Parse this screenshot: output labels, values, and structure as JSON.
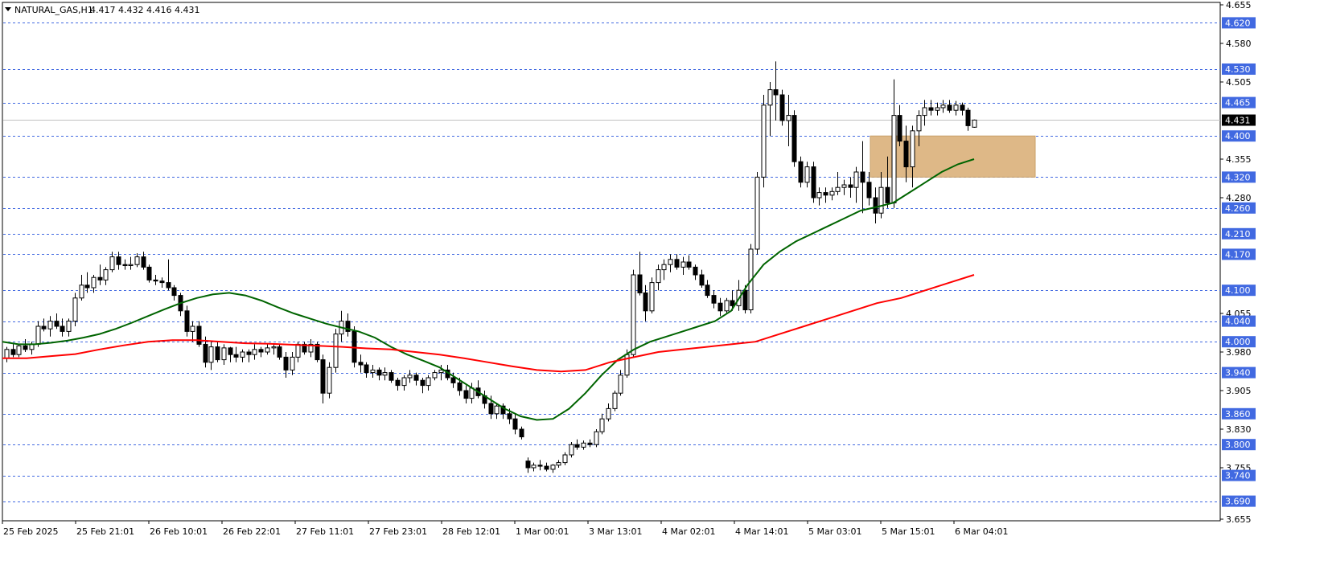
{
  "header": {
    "menu_icon": "triangle-down-icon",
    "symbol": "NATURAL_GAS,H1",
    "ohlc": "4.417 4.432 4.416 4.431"
  },
  "chart_data": {
    "type": "candlestick",
    "symbol": "NATURAL_GAS",
    "timeframe": "H1",
    "ylim": [
      3.655,
      4.655
    ],
    "y_ticks": [
      "4.655",
      "4.580",
      "4.505",
      "4.355",
      "4.280",
      "4.055",
      "3.980",
      "3.905",
      "3.830",
      "3.755",
      "3.655"
    ],
    "x_ticks": [
      "25 Feb 2025",
      "25 Feb 21:01",
      "26 Feb 10:01",
      "26 Feb 22:01",
      "27 Feb 11:01",
      "27 Feb 23:01",
      "28 Feb 12:01",
      "1 Mar 00:01",
      "3 Mar 13:01",
      "4 Mar 02:01",
      "4 Mar 14:01",
      "5 Mar 03:01",
      "5 Mar 15:01",
      "6 Mar 04:01"
    ],
    "current_price": "4.431",
    "level_lines": [
      "4.620",
      "4.530",
      "4.465",
      "4.400",
      "4.320",
      "4.260",
      "4.210",
      "4.170",
      "4.100",
      "4.040",
      "4.000",
      "3.940",
      "3.860",
      "3.800",
      "3.740",
      "3.690"
    ],
    "zone": {
      "from": 4.32,
      "to": 4.4,
      "color": "#deb887"
    },
    "colors": {
      "up_body": "#ffffff",
      "down_body": "#000000",
      "wick": "#000000",
      "grid": "#4169e1",
      "label_bg": "#4169e1",
      "ma_fast": "#006400",
      "ma_slow": "#ff0000",
      "current_line": "#c0c0c0",
      "current_label_bg": "#000000"
    },
    "candles": [
      [
        3.968,
        3.99,
        3.96,
        3.985
      ],
      [
        3.985,
        3.995,
        3.97,
        3.975
      ],
      [
        3.975,
        3.995,
        3.97,
        3.992
      ],
      [
        3.992,
        4.005,
        3.98,
        3.985
      ],
      [
        3.985,
        4.0,
        3.975,
        3.995
      ],
      [
        3.995,
        4.04,
        3.99,
        4.03
      ],
      [
        4.03,
        4.045,
        4.02,
        4.025
      ],
      [
        4.025,
        4.05,
        4.01,
        4.04
      ],
      [
        4.04,
        4.055,
        4.025,
        4.03
      ],
      [
        4.03,
        4.045,
        4.01,
        4.02
      ],
      [
        4.02,
        4.045,
        4.01,
        4.04
      ],
      [
        4.04,
        4.095,
        4.03,
        4.085
      ],
      [
        4.085,
        4.13,
        4.08,
        4.11
      ],
      [
        4.11,
        4.135,
        4.095,
        4.105
      ],
      [
        4.105,
        4.13,
        4.095,
        4.125
      ],
      [
        4.125,
        4.15,
        4.11,
        4.12
      ],
      [
        4.12,
        4.145,
        4.11,
        4.14
      ],
      [
        4.14,
        4.175,
        4.135,
        4.165
      ],
      [
        4.165,
        4.175,
        4.14,
        4.15
      ],
      [
        4.15,
        4.16,
        4.14,
        4.148
      ],
      [
        4.148,
        4.165,
        4.14,
        4.15
      ],
      [
        4.15,
        4.172,
        4.145,
        4.165
      ],
      [
        4.165,
        4.175,
        4.14,
        4.145
      ],
      [
        4.145,
        4.15,
        4.115,
        4.12
      ],
      [
        4.12,
        4.13,
        4.11,
        4.118
      ],
      [
        4.118,
        4.125,
        4.105,
        4.115
      ],
      [
        4.115,
        4.16,
        4.1,
        4.105
      ],
      [
        4.105,
        4.11,
        4.08,
        4.09
      ],
      [
        4.09,
        4.095,
        4.05,
        4.06
      ],
      [
        4.06,
        4.07,
        4.01,
        4.02
      ],
      [
        4.02,
        4.04,
        4.0,
        4.03
      ],
      [
        4.03,
        4.04,
        3.99,
        3.995
      ],
      [
        3.995,
        4.01,
        3.95,
        3.96
      ],
      [
        3.96,
        4.0,
        3.945,
        3.99
      ],
      [
        3.99,
        4.0,
        3.96,
        3.965
      ],
      [
        3.965,
        3.995,
        3.955,
        3.988
      ],
      [
        3.988,
        3.99,
        3.96,
        3.975
      ],
      [
        3.975,
        3.99,
        3.96,
        3.97
      ],
      [
        3.97,
        3.985,
        3.96,
        3.98
      ],
      [
        3.98,
        3.985,
        3.96,
        3.975
      ],
      [
        3.975,
        3.995,
        3.965,
        3.985
      ],
      [
        3.985,
        3.99,
        3.97,
        3.98
      ],
      [
        3.98,
        3.995,
        3.975,
        3.988
      ],
      [
        3.988,
        3.995,
        3.975,
        3.99
      ],
      [
        3.99,
        3.995,
        3.965,
        3.97
      ],
      [
        3.97,
        3.98,
        3.93,
        3.945
      ],
      [
        3.945,
        3.98,
        3.935,
        3.97
      ],
      [
        3.97,
        4.0,
        3.96,
        3.995
      ],
      [
        3.995,
        4.0,
        3.975,
        3.98
      ],
      [
        3.98,
        4.005,
        3.97,
        3.995
      ],
      [
        3.995,
        4.0,
        3.96,
        3.965
      ],
      [
        3.965,
        3.975,
        3.88,
        3.9
      ],
      [
        3.9,
        3.96,
        3.89,
        3.95
      ],
      [
        3.95,
        4.025,
        3.94,
        4.015
      ],
      [
        4.015,
        4.06,
        4.0,
        4.04
      ],
      [
        4.04,
        4.055,
        4.01,
        4.02
      ],
      [
        4.02,
        4.03,
        3.95,
        3.96
      ],
      [
        3.96,
        3.975,
        3.94,
        3.955
      ],
      [
        3.955,
        3.96,
        3.93,
        3.94
      ],
      [
        3.94,
        3.955,
        3.93,
        3.945
      ],
      [
        3.945,
        3.95,
        3.925,
        3.935
      ],
      [
        3.935,
        3.95,
        3.925,
        3.94
      ],
      [
        3.94,
        3.945,
        3.92,
        3.925
      ],
      [
        3.925,
        3.93,
        3.905,
        3.915
      ],
      [
        3.915,
        3.935,
        3.905,
        3.93
      ],
      [
        3.93,
        3.945,
        3.92,
        3.935
      ],
      [
        3.935,
        3.94,
        3.915,
        3.925
      ],
      [
        3.925,
        3.93,
        3.9,
        3.915
      ],
      [
        3.915,
        3.935,
        3.905,
        3.93
      ],
      [
        3.93,
        3.945,
        3.925,
        3.94
      ],
      [
        3.94,
        3.955,
        3.925,
        3.945
      ],
      [
        3.945,
        3.955,
        3.925,
        3.93
      ],
      [
        3.93,
        3.94,
        3.91,
        3.92
      ],
      [
        3.92,
        3.93,
        3.895,
        3.905
      ],
      [
        3.905,
        3.915,
        3.88,
        3.89
      ],
      [
        3.89,
        3.92,
        3.88,
        3.91
      ],
      [
        3.91,
        3.925,
        3.89,
        3.895
      ],
      [
        3.895,
        3.905,
        3.87,
        3.88
      ],
      [
        3.88,
        3.895,
        3.85,
        3.86
      ],
      [
        3.86,
        3.88,
        3.85,
        3.875
      ],
      [
        3.875,
        3.88,
        3.85,
        3.86
      ],
      [
        3.86,
        3.87,
        3.84,
        3.85
      ],
      [
        3.85,
        3.86,
        3.82,
        3.83
      ],
      [
        3.83,
        3.835,
        3.81,
        3.815
      ],
      [
        3.768,
        3.775,
        3.745,
        3.755
      ],
      [
        3.755,
        3.765,
        3.748,
        3.76
      ],
      [
        3.76,
        3.77,
        3.75,
        3.758
      ],
      [
        3.758,
        3.765,
        3.748,
        3.752
      ],
      [
        3.752,
        3.762,
        3.745,
        3.76
      ],
      [
        3.76,
        3.77,
        3.755,
        3.765
      ],
      [
        3.765,
        3.785,
        3.76,
        3.78
      ],
      [
        3.78,
        3.805,
        3.775,
        3.8
      ],
      [
        3.8,
        3.81,
        3.79,
        3.795
      ],
      [
        3.795,
        3.808,
        3.79,
        3.803
      ],
      [
        3.803,
        3.81,
        3.795,
        3.8
      ],
      [
        3.8,
        3.83,
        3.795,
        3.825
      ],
      [
        3.825,
        3.86,
        3.82,
        3.85
      ],
      [
        3.85,
        3.88,
        3.845,
        3.87
      ],
      [
        3.87,
        3.905,
        3.865,
        3.9
      ],
      [
        3.9,
        3.945,
        3.895,
        3.935
      ],
      [
        3.935,
        3.985,
        3.93,
        3.975
      ],
      [
        3.975,
        4.14,
        3.97,
        4.13
      ],
      [
        4.13,
        4.175,
        4.09,
        4.095
      ],
      [
        4.095,
        4.11,
        4.04,
        4.06
      ],
      [
        4.06,
        4.125,
        4.055,
        4.115
      ],
      [
        4.115,
        4.15,
        4.1,
        4.14
      ],
      [
        4.14,
        4.16,
        4.12,
        4.15
      ],
      [
        4.15,
        4.17,
        4.135,
        4.16
      ],
      [
        4.16,
        4.17,
        4.14,
        4.145
      ],
      [
        4.145,
        4.165,
        4.13,
        4.155
      ],
      [
        4.155,
        4.168,
        4.14,
        4.145
      ],
      [
        4.145,
        4.15,
        4.12,
        4.13
      ],
      [
        4.13,
        4.14,
        4.105,
        4.11
      ],
      [
        4.11,
        4.12,
        4.085,
        4.09
      ],
      [
        4.09,
        4.1,
        4.065,
        4.075
      ],
      [
        4.075,
        4.085,
        4.05,
        4.06
      ],
      [
        4.06,
        4.085,
        4.055,
        4.08
      ],
      [
        4.08,
        4.1,
        4.06,
        4.07
      ],
      [
        4.07,
        4.12,
        4.06,
        4.1
      ],
      [
        4.1,
        4.11,
        4.055,
        4.062
      ],
      [
        4.062,
        4.19,
        4.055,
        4.18
      ],
      [
        4.18,
        4.33,
        4.17,
        4.32
      ],
      [
        4.32,
        4.48,
        4.3,
        4.46
      ],
      [
        4.46,
        4.505,
        4.4,
        4.49
      ],
      [
        4.49,
        4.545,
        4.43,
        4.48
      ],
      [
        4.48,
        4.49,
        4.42,
        4.43
      ],
      [
        4.43,
        4.48,
        4.38,
        4.44
      ],
      [
        4.44,
        4.45,
        4.34,
        4.35
      ],
      [
        4.35,
        4.36,
        4.3,
        4.31
      ],
      [
        4.31,
        4.35,
        4.3,
        4.34
      ],
      [
        4.34,
        4.35,
        4.27,
        4.28
      ],
      [
        4.28,
        4.3,
        4.265,
        4.29
      ],
      [
        4.29,
        4.3,
        4.27,
        4.285
      ],
      [
        4.285,
        4.3,
        4.275,
        4.292
      ],
      [
        4.292,
        4.33,
        4.285,
        4.3
      ],
      [
        4.3,
        4.315,
        4.285,
        4.305
      ],
      [
        4.305,
        4.32,
        4.28,
        4.3
      ],
      [
        4.3,
        4.34,
        4.27,
        4.33
      ],
      [
        4.33,
        4.39,
        4.25,
        4.31
      ],
      [
        4.31,
        4.33,
        4.265,
        4.28
      ],
      [
        4.28,
        4.3,
        4.23,
        4.25
      ],
      [
        4.25,
        4.33,
        4.24,
        4.3
      ],
      [
        4.3,
        4.36,
        4.26,
        4.27
      ],
      [
        4.27,
        4.51,
        4.26,
        4.44
      ],
      [
        4.44,
        4.46,
        4.38,
        4.39
      ],
      [
        4.39,
        4.42,
        4.31,
        4.34
      ],
      [
        4.34,
        4.42,
        4.3,
        4.41
      ],
      [
        4.41,
        4.45,
        4.38,
        4.44
      ],
      [
        4.44,
        4.47,
        4.42,
        4.455
      ],
      [
        4.455,
        4.47,
        4.44,
        4.45
      ],
      [
        4.45,
        4.465,
        4.44,
        4.455
      ],
      [
        4.455,
        4.47,
        4.445,
        4.46
      ],
      [
        4.46,
        4.47,
        4.445,
        4.45
      ],
      [
        4.45,
        4.468,
        4.44,
        4.46
      ],
      [
        4.46,
        4.465,
        4.44,
        4.45
      ],
      [
        4.45,
        4.455,
        4.41,
        4.42
      ],
      [
        4.417,
        4.432,
        4.416,
        4.431
      ]
    ],
    "ma_fast_values": [
      4.0,
      3.995,
      3.995,
      3.998,
      4.002,
      4.008,
      4.015,
      4.025,
      4.037,
      4.05,
      4.063,
      4.075,
      4.085,
      4.092,
      4.095,
      4.09,
      4.08,
      4.067,
      4.055,
      4.045,
      4.035,
      4.027,
      4.02,
      4.008,
      3.99,
      3.975,
      3.963,
      3.95,
      3.93,
      3.91,
      3.89,
      3.87,
      3.855,
      3.848,
      3.85,
      3.87,
      3.9,
      3.935,
      3.965,
      3.985,
      4.0,
      4.01,
      4.02,
      4.03,
      4.04,
      4.06,
      4.11,
      4.15,
      4.175,
      4.195,
      4.21,
      4.225,
      4.24,
      4.255,
      4.262,
      4.27,
      4.29,
      4.31,
      4.33,
      4.345,
      4.355
    ],
    "ma_slow_values": [
      3.968,
      3.968,
      3.972,
      3.976,
      3.985,
      3.993,
      4.0,
      4.003,
      4.003,
      4.0,
      3.997,
      3.996,
      3.994,
      3.992,
      3.99,
      3.987,
      3.985,
      3.98,
      3.975,
      3.968,
      3.96,
      3.952,
      3.945,
      3.942,
      3.945,
      3.96,
      3.97,
      3.98,
      3.985,
      3.99,
      3.995,
      4.0,
      4.015,
      4.03,
      4.045,
      4.06,
      4.075,
      4.085,
      4.1,
      4.115,
      4.13
    ]
  }
}
